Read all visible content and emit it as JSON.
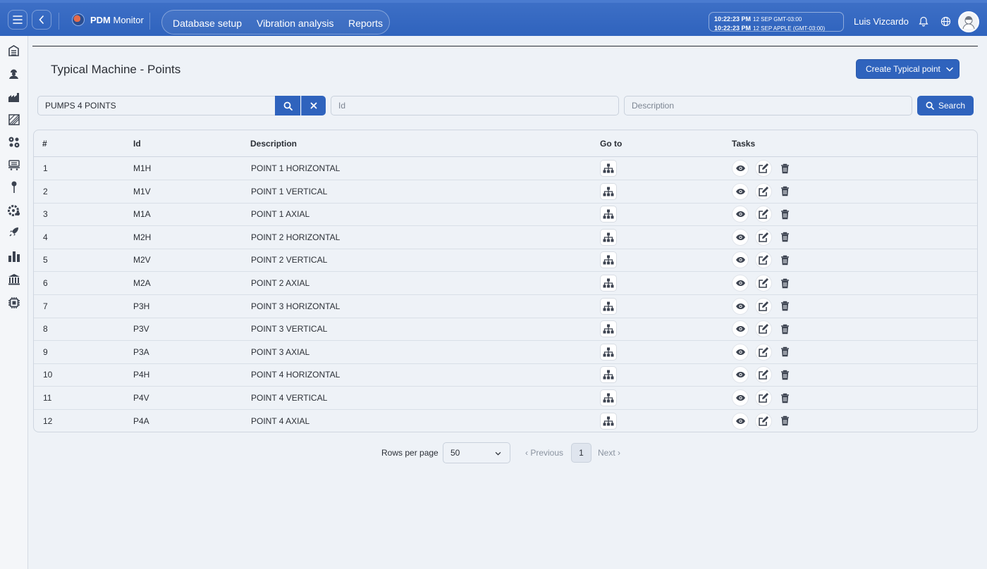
{
  "header": {
    "app_name_bold": "PDM",
    "app_name_rest": " Monitor",
    "nav": [
      "Database setup",
      "Vibration analysis",
      "Reports"
    ],
    "clock_line1_time": "10:22:23 PM",
    "clock_line1_meta": "12 SEP  GMT-03:00",
    "clock_line2_time": "10:22:23 PM",
    "clock_line2_meta": "12 SEP  APPLE (GMT-03:00)",
    "user_name": "Luis Vizcardo"
  },
  "sidebar": {
    "icons": [
      "buildings-icon",
      "worker-icon",
      "factory-icon",
      "hatch-area-icon",
      "gears-icon",
      "conveyor-icon",
      "pin-icon",
      "gear-settings-icon",
      "rocket-icon",
      "bar-chart-icon",
      "bank-icon",
      "chip-icon"
    ]
  },
  "page": {
    "title": "Typical Machine - Points",
    "create_button": "Create Typical point"
  },
  "filters": {
    "machine_value": "PUMPS 4 POINTS",
    "id_placeholder": "Id",
    "description_placeholder": "Description",
    "search_button": "Search"
  },
  "table": {
    "headers": {
      "num": "#",
      "id": "Id",
      "description": "Description",
      "goto": "Go to",
      "tasks": "Tasks"
    },
    "rows": [
      {
        "num": "1",
        "id": "M1H",
        "description": "POINT 1 HORIZONTAL"
      },
      {
        "num": "2",
        "id": "M1V",
        "description": "POINT 1 VERTICAL"
      },
      {
        "num": "3",
        "id": "M1A",
        "description": "POINT 1 AXIAL"
      },
      {
        "num": "4",
        "id": "M2H",
        "description": "POINT 2 HORIZONTAL"
      },
      {
        "num": "5",
        "id": "M2V",
        "description": "POINT 2 VERTICAL"
      },
      {
        "num": "6",
        "id": "M2A",
        "description": "POINT 2 AXIAL"
      },
      {
        "num": "7",
        "id": "P3H",
        "description": "POINT 3 HORIZONTAL"
      },
      {
        "num": "8",
        "id": "P3V",
        "description": "POINT 3 VERTICAL"
      },
      {
        "num": "9",
        "id": "P3A",
        "description": "POINT 3 AXIAL"
      },
      {
        "num": "10",
        "id": "P4H",
        "description": "POINT 4 HORIZONTAL"
      },
      {
        "num": "11",
        "id": "P4V",
        "description": "POINT 4 VERTICAL"
      },
      {
        "num": "12",
        "id": "P4A",
        "description": "POINT 4 AXIAL"
      }
    ]
  },
  "pagination": {
    "rows_per_page_label": "Rows per page",
    "rows_per_page_value": "50",
    "previous": "Previous",
    "next": "Next",
    "current_page": "1"
  },
  "colors": {
    "primary": "#2f63bd",
    "background": "#eef2f7"
  }
}
